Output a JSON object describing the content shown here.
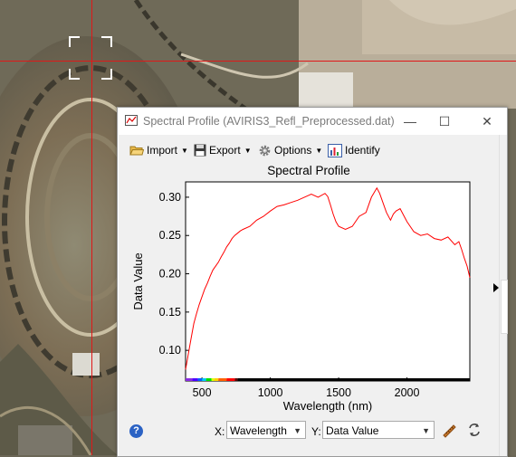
{
  "window": {
    "title": "Spectral Profile (AVIRIS3_Refl_Preprocessed.dat)",
    "minimize_glyph": "—",
    "maximize_glyph": "☐",
    "close_glyph": "✕"
  },
  "toolbar": {
    "import_label": "Import",
    "export_label": "Export",
    "options_label": "Options",
    "identify_label": "Identify"
  },
  "chart_data": {
    "type": "line",
    "title": "Spectral Profile",
    "xlabel": "Wavelength (nm)",
    "ylabel": "Data Value",
    "xlim": [
      380,
      2460
    ],
    "ylim": [
      0.06,
      0.32
    ],
    "xticks": [
      "500",
      "1000",
      "1500",
      "2000"
    ],
    "xtick_values": [
      500,
      1000,
      1500,
      2000
    ],
    "yticks": [
      "0.30",
      "0.25",
      "0.20",
      "0.15",
      "0.10"
    ],
    "ytick_values": [
      0.3,
      0.25,
      0.2,
      0.15,
      0.1
    ],
    "series": [
      {
        "color": "#ff0000",
        "x": [
          380,
          400,
          420,
          440,
          460,
          480,
          500,
          520,
          540,
          560,
          580,
          600,
          620,
          640,
          660,
          680,
          700,
          720,
          740,
          760,
          780,
          800,
          850,
          900,
          950,
          1000,
          1050,
          1100,
          1150,
          1200,
          1250,
          1300,
          1350,
          1400,
          1420,
          1440,
          1460,
          1480,
          1500,
          1550,
          1600,
          1650,
          1700,
          1740,
          1780,
          1800,
          1820,
          1850,
          1880,
          1900,
          1920,
          1950,
          1980,
          2000,
          2050,
          2100,
          2150,
          2200,
          2250,
          2300,
          2350,
          2380,
          2400,
          2420,
          2440,
          2460
        ],
        "y": [
          0.075,
          0.095,
          0.115,
          0.135,
          0.148,
          0.16,
          0.17,
          0.18,
          0.188,
          0.197,
          0.205,
          0.21,
          0.215,
          0.222,
          0.228,
          0.235,
          0.24,
          0.246,
          0.25,
          0.253,
          0.256,
          0.258,
          0.262,
          0.27,
          0.275,
          0.282,
          0.288,
          0.29,
          0.293,
          0.296,
          0.3,
          0.304,
          0.3,
          0.305,
          0.301,
          0.29,
          0.278,
          0.268,
          0.262,
          0.258,
          0.262,
          0.275,
          0.28,
          0.3,
          0.312,
          0.305,
          0.295,
          0.28,
          0.27,
          0.278,
          0.282,
          0.285,
          0.275,
          0.268,
          0.255,
          0.25,
          0.252,
          0.246,
          0.244,
          0.248,
          0.238,
          0.242,
          0.232,
          0.22,
          0.21,
          0.195
        ]
      }
    ]
  },
  "footer": {
    "help_label": "?",
    "x_axis_label": "X:",
    "x_axis_value": "Wavelength",
    "y_axis_label": "Y:",
    "y_axis_value": "Data Value"
  },
  "colors": {
    "crosshair": "#e01818",
    "plot_line": "#ff0000",
    "window_bg": "#f0f0f0",
    "help_icon": "#2b62c4"
  },
  "icons": [
    "folder-open-icon",
    "floppy-disk-icon",
    "gear-icon",
    "identify-chart-icon",
    "help-icon",
    "ruler-icon",
    "refresh-icon",
    "chevron-down-icon"
  ]
}
